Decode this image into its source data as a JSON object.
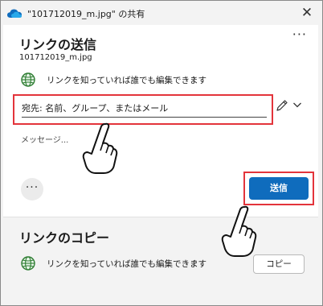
{
  "window": {
    "title": "\"101712019_m.jpg\" の共有",
    "close_glyph": "✕",
    "icon": "onedrive-cloud-icon"
  },
  "send_section": {
    "title": "リンクの送信",
    "file_name": "101712019_m.jpg",
    "more_glyph": "···",
    "permission": {
      "text": "リンクを知っていれば誰でも編集できます",
      "chevron": "›",
      "icon": "globe-icon"
    },
    "recipients": {
      "placeholder": "宛先: 名前、グループ、またはメール"
    },
    "message_placeholder": "メッセージ...",
    "options_glyph": "···",
    "send_label": "送信"
  },
  "copy_section": {
    "title": "リンクのコピー",
    "permission": {
      "text": "リンクを知っていれば誰でも編集できます",
      "chevron": "›",
      "icon": "globe-icon"
    },
    "copy_label": "コピー"
  },
  "colors": {
    "accent": "#0f6cbd",
    "highlight": "#e3343b",
    "globe": "#2e7d32"
  }
}
